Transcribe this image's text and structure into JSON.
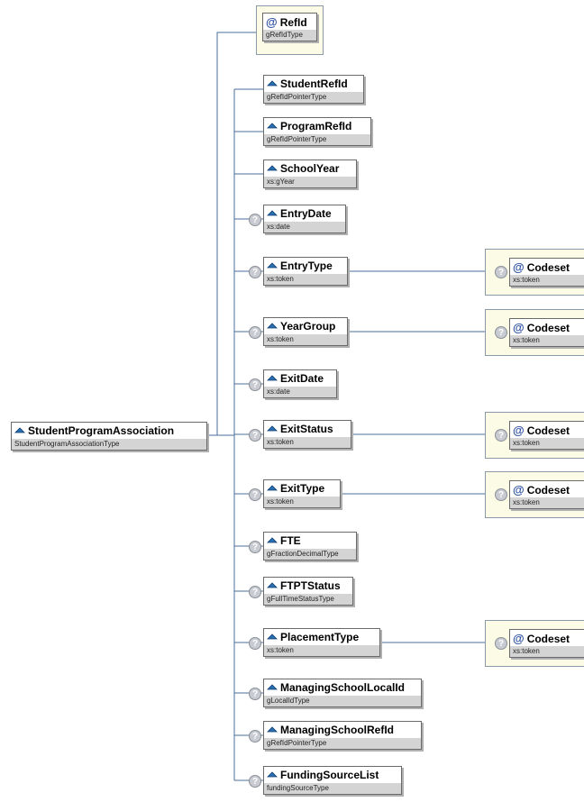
{
  "root": {
    "name": "StudentProgramAssociation",
    "type": "StudentProgramAssociationType"
  },
  "attribute": {
    "name": "RefId",
    "type": "gRefIdType"
  },
  "optional_marker": "?",
  "attribute_prefix": "@",
  "elements": [
    {
      "name": "StudentRefId",
      "type": "gRefIdPointerType",
      "optional": false
    },
    {
      "name": "ProgramRefId",
      "type": "gRefIdPointerType",
      "optional": false
    },
    {
      "name": "SchoolYear",
      "type": "xs:gYear",
      "optional": false
    },
    {
      "name": "EntryDate",
      "type": "xs:date",
      "optional": true
    },
    {
      "name": "EntryType",
      "type": "xs:token",
      "optional": true,
      "codeset": {
        "name": "Codeset",
        "type": "xs:token"
      }
    },
    {
      "name": "YearGroup",
      "type": "xs:token",
      "optional": true,
      "codeset": {
        "name": "Codeset",
        "type": "xs:token"
      }
    },
    {
      "name": "ExitDate",
      "type": "xs:date",
      "optional": true
    },
    {
      "name": "ExitStatus",
      "type": "xs:token",
      "optional": true,
      "codeset": {
        "name": "Codeset",
        "type": "xs:token"
      }
    },
    {
      "name": "ExitType",
      "type": "xs:token",
      "optional": true,
      "codeset": {
        "name": "Codeset",
        "type": "xs:token"
      }
    },
    {
      "name": "FTE",
      "type": "gFractionDecimalType",
      "optional": true
    },
    {
      "name": "FTPTStatus",
      "type": "gFullTimeStatusType",
      "optional": true
    },
    {
      "name": "PlacementType",
      "type": "xs:token",
      "optional": true,
      "codeset": {
        "name": "Codeset",
        "type": "xs:token"
      }
    },
    {
      "name": "ManagingSchoolLocalId",
      "type": "gLocalIdType",
      "optional": true
    },
    {
      "name": "ManagingSchoolRefId",
      "type": "gRefIdPointerType",
      "optional": true
    },
    {
      "name": "FundingSourceList",
      "type": "fundingSourceType",
      "optional": true
    }
  ],
  "colors": {
    "line": "#4a6f9a",
    "attribute_bg": "#fcfce6",
    "type_bar": "#d4d4d4",
    "icon": "#2a6fb0"
  }
}
